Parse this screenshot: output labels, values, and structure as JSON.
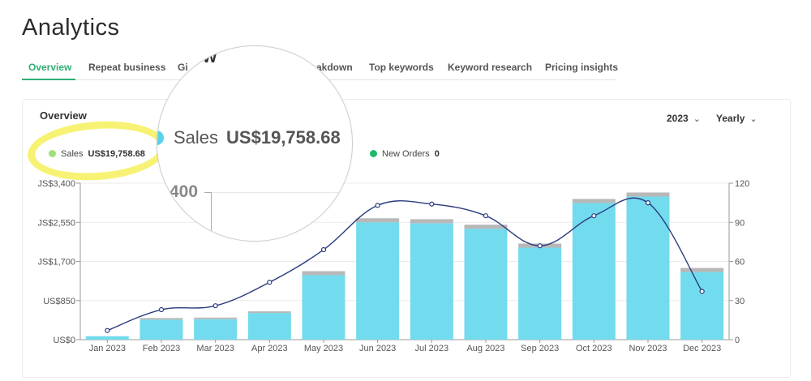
{
  "page": {
    "title": "Analytics"
  },
  "tabs": [
    {
      "label": "Overview",
      "active": true
    },
    {
      "label": "Repeat business",
      "active": false
    },
    {
      "label": "Gi",
      "active": false
    },
    {
      "label": "akdown",
      "active": false
    },
    {
      "label": "Top keywords",
      "active": false
    },
    {
      "label": "Keyword research",
      "active": false
    },
    {
      "label": "Pricing insights",
      "active": false
    }
  ],
  "card": {
    "title": "Overview",
    "year_dropdown": "2023",
    "period_dropdown": "Yearly"
  },
  "legend": {
    "sales_label": "Sales",
    "sales_value": "US$19,758.68",
    "orders_label": "New Orders",
    "orders_value": "0",
    "sales_color": "#9ee07a",
    "orders_color": "#1fb86a"
  },
  "magnifier": {
    "sales_label": "Sales",
    "sales_value": "US$19,758.68",
    "partial_heading": "w",
    "partial_tick": "400",
    "dot_color": "#5ad2ea"
  },
  "icons": {
    "chevron": "chevron-down-icon",
    "legend_dot": "legend-dot-icon"
  },
  "colors": {
    "bar": "#72dbed",
    "bar_cap": "#b8b8b8",
    "line": "#2b3a7e",
    "accent": "#2fae74",
    "highlight": "#f6f05a"
  },
  "chart_data": {
    "type": "bar",
    "categories": [
      "Jan 2023",
      "Feb 2023",
      "Mar 2023",
      "Apr 2023",
      "May 2023",
      "Jun 2023",
      "Jul 2023",
      "Aug 2023",
      "Sep 2023",
      "Oct 2023",
      "Nov 2023",
      "Dec 2023"
    ],
    "series": [
      {
        "type": "bar",
        "axis": "left",
        "values": [
          75,
          435,
          445,
          580,
          1400,
          2550,
          2530,
          2410,
          2000,
          2970,
          3110,
          1470
        ]
      },
      {
        "type": "line",
        "axis": "right",
        "values": [
          7,
          23,
          26,
          44,
          69,
          103,
          104,
          95,
          72,
          95,
          105,
          37
        ]
      }
    ],
    "y_left": {
      "ylim": [
        0,
        3400
      ],
      "ticks": [
        0,
        850,
        1700,
        2550,
        3400
      ],
      "tick_labels": [
        "US$0",
        "US$850",
        "JS$1,700",
        "JS$2,550",
        "JS$3,400"
      ]
    },
    "y_right": {
      "ylim": [
        0,
        120
      ],
      "ticks": [
        0,
        30,
        60,
        90,
        120
      ],
      "tick_labels": [
        "0",
        "30",
        "60",
        "90",
        "120"
      ]
    },
    "grid": true
  }
}
